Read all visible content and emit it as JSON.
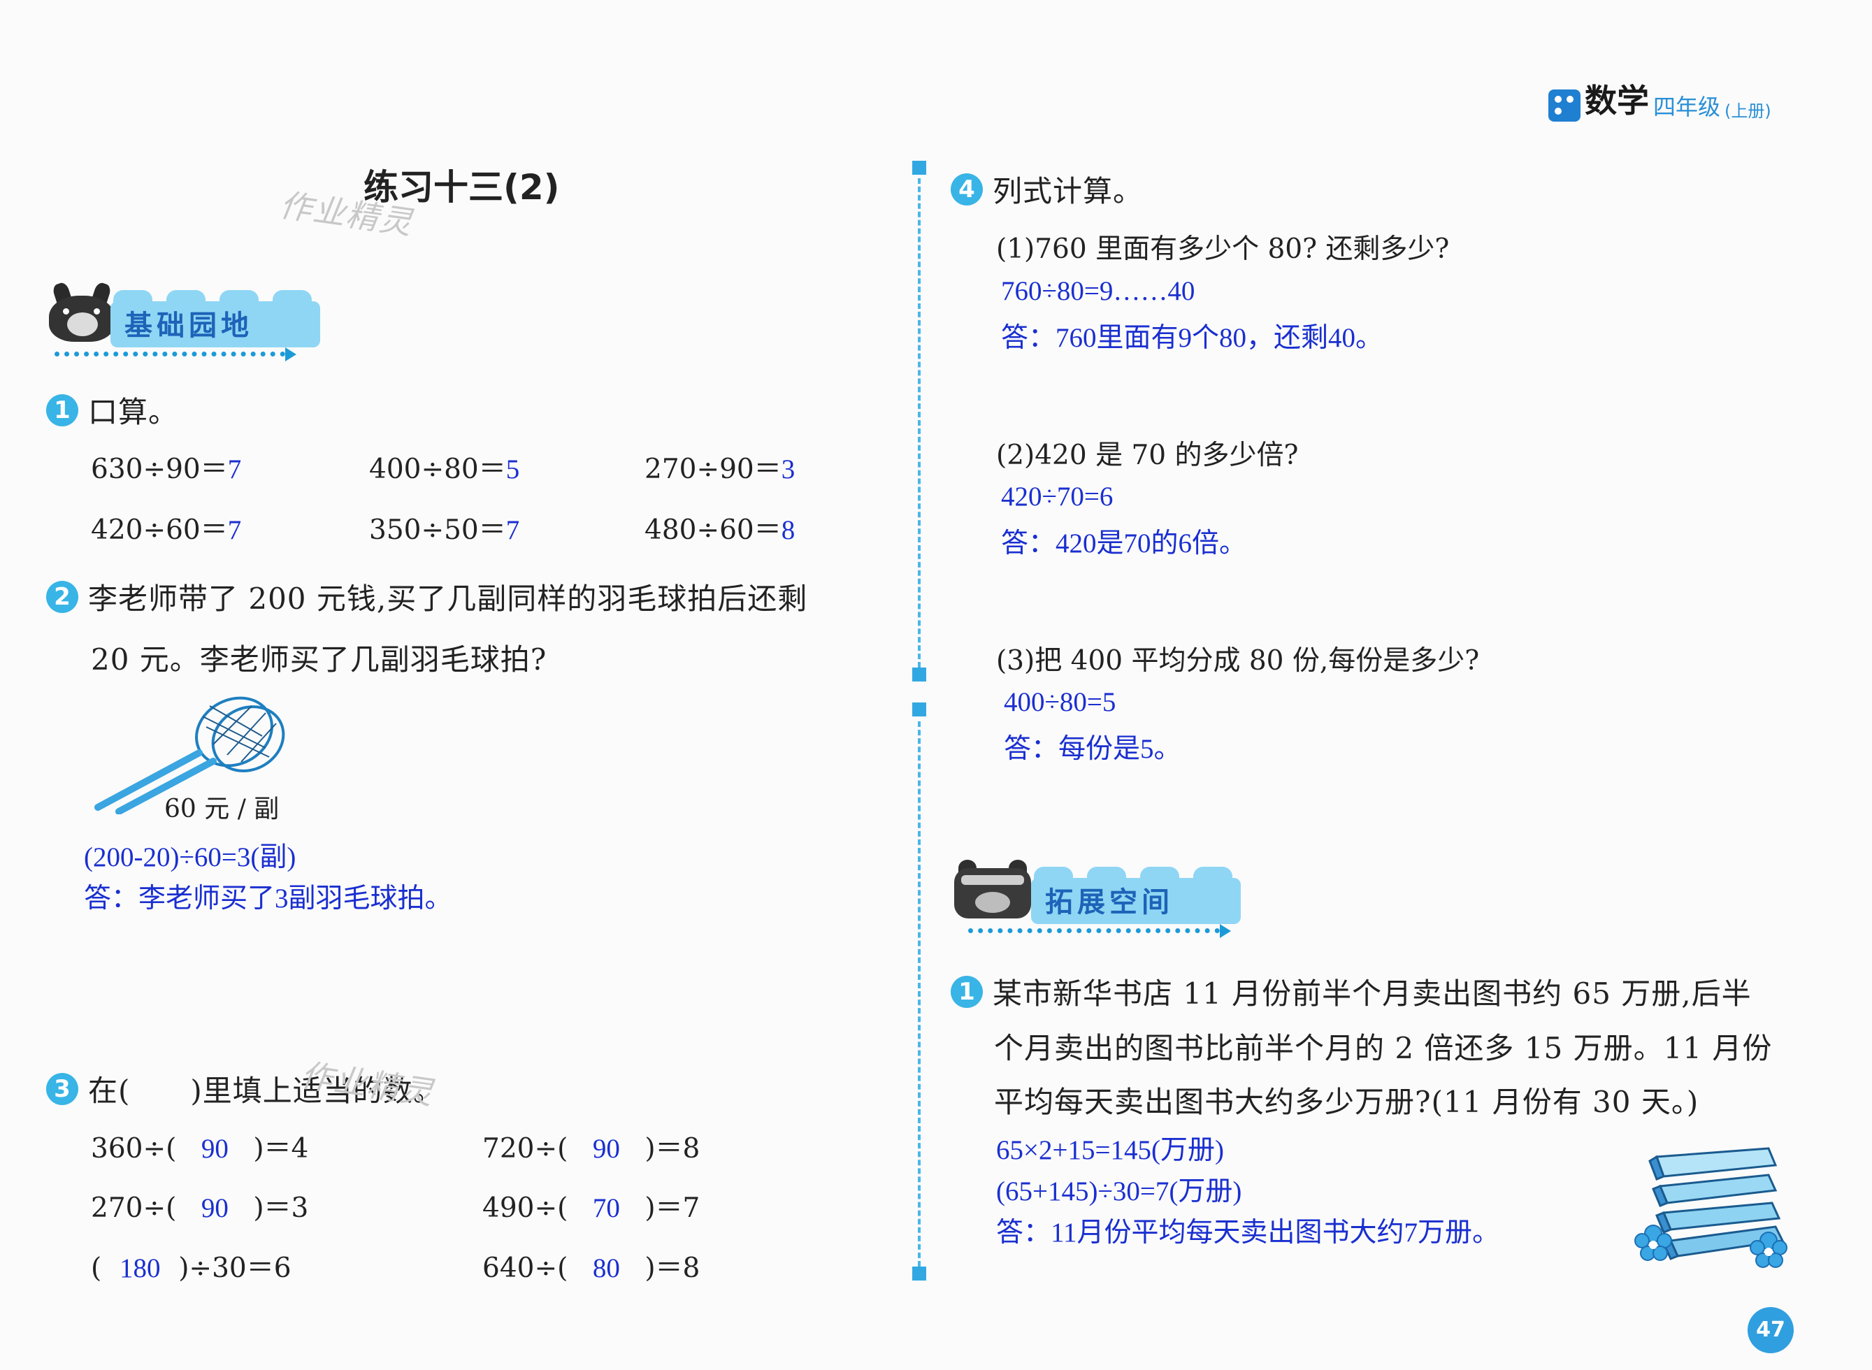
{
  "header": {
    "subject": "数学",
    "grade": "四年级",
    "volume": "(上册)",
    "page_number": "47"
  },
  "left": {
    "title": "练习十三(2)",
    "watermark": "作业精灵",
    "section_basic": "基础园地",
    "q1": {
      "num": "1",
      "prompt": "口算。",
      "items": [
        {
          "expr": "630÷90＝",
          "ans": "7"
        },
        {
          "expr": "400÷80＝",
          "ans": "5"
        },
        {
          "expr": "270÷90＝",
          "ans": "3"
        },
        {
          "expr": "420÷60＝",
          "ans": "7"
        },
        {
          "expr": "350÷50＝",
          "ans": "7"
        },
        {
          "expr": "480÷60＝",
          "ans": "8"
        }
      ]
    },
    "q2": {
      "num": "2",
      "line1": "李老师带了 200 元钱,买了几副同样的羽毛球拍后还剩",
      "line2": "20 元。李老师买了几副羽毛球拍?",
      "price": "60 元 / 副",
      "calc": "(200-20)÷60=3(副)",
      "answer": "答：李老师买了3副羽毛球拍。"
    },
    "q3": {
      "num": "3",
      "prompt": "在(　　)里填上适当的数。",
      "items": [
        {
          "pre": "360÷(",
          "ans": "90",
          "post": ")＝4"
        },
        {
          "pre": "720÷(",
          "ans": "90",
          "post": ")＝8"
        },
        {
          "pre": "270÷(",
          "ans": "90",
          "post": ")＝3"
        },
        {
          "pre": "490÷(",
          "ans": "70",
          "post": ")＝7"
        },
        {
          "pre": "(",
          "ans": "180",
          "post": ")÷30＝6"
        },
        {
          "pre": "640÷(",
          "ans": "80",
          "post": ")＝8"
        }
      ]
    }
  },
  "right": {
    "q4": {
      "num": "4",
      "prompt": "列式计算。",
      "parts": [
        {
          "question": "(1)760 里面有多少个 80? 还剩多少?",
          "calc": "760÷80=9……40",
          "answer": "答：760里面有9个80，还剩40。"
        },
        {
          "question": "(2)420 是 70 的多少倍?",
          "calc": "420÷70=6",
          "answer": "答：420是70的6倍。"
        },
        {
          "question": "(3)把 400 平均分成 80 份,每份是多少?",
          "calc": "400÷80=5",
          "answer": "答：每份是5。"
        }
      ]
    },
    "section_extend": "拓展空间",
    "ext1": {
      "num": "1",
      "line1": "某市新华书店 11 月份前半个月卖出图书约 65 万册,后半",
      "line2": "个月卖出的图书比前半个月的 2 倍还多 15 万册。11 月份",
      "line3": "平均每天卖出图书大约多少万册?(11 月份有 30 天。)",
      "calc1": "65×2+15=145(万册)",
      "calc2": "(65+145)÷30=7(万册)",
      "answer": "答：11月份平均每天卖出图书大约7万册。"
    }
  },
  "colors": {
    "accent_blue": "#38b4e6",
    "answer_blue": "#1a2fd0",
    "banner_blue": "#8fd6f4"
  }
}
